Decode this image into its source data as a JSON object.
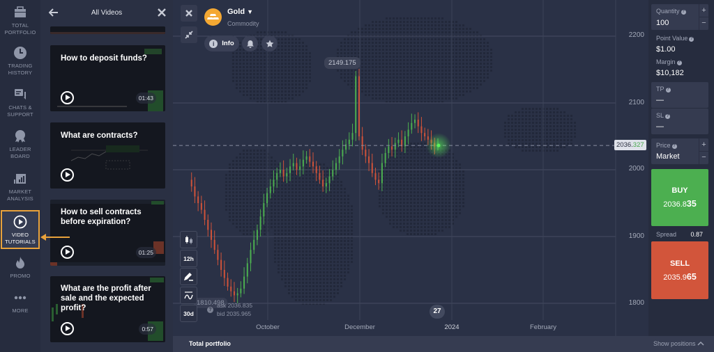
{
  "nav": {
    "items": [
      {
        "label_l1": "TOTAL",
        "label_l2": "PORTFOLIO",
        "icon": "briefcase-icon"
      },
      {
        "label_l1": "TRADING",
        "label_l2": "HISTORY",
        "icon": "clock-icon"
      },
      {
        "label_l1": "CHATS &",
        "label_l2": "SUPPORT",
        "icon": "chat-icon"
      },
      {
        "label_l1": "LEADER",
        "label_l2": "BOARD",
        "icon": "medal-icon"
      },
      {
        "label_l1": "MARKET",
        "label_l2": "ANALYSIS",
        "icon": "bar-chart-icon"
      },
      {
        "label_l1": "VIDEO",
        "label_l2": "TUTORIALS",
        "icon": "play-circle-icon",
        "active": true
      },
      {
        "label_l1": "PROMO",
        "label_l2": "",
        "icon": "flame-icon"
      },
      {
        "label_l1": "MORE",
        "label_l2": "",
        "icon": "more-dots-icon"
      }
    ],
    "highlight_color": "#e9a23b"
  },
  "videos_panel": {
    "title": "All Videos",
    "videos": [
      {
        "title": "How to deposit funds?",
        "duration": "01:43"
      },
      {
        "title": "What are contracts?",
        "duration": ""
      },
      {
        "title": "How to sell contracts before expiration?",
        "duration": "01:25"
      },
      {
        "title": "What are the profit after sale and the expected profit?",
        "duration": "0:57"
      }
    ]
  },
  "asset": {
    "name": "Gold",
    "type": "Commodity",
    "info_label": "Info"
  },
  "chart": {
    "high_label": "2149.175",
    "low_label": "1810.498",
    "current_price_main": "2036.",
    "current_price_tail": "327",
    "ask": "ask 2036.835",
    "bid": "bid 2035.965",
    "day_badge": "27",
    "y_ticks": [
      "2200",
      "2100",
      "2000",
      "1900",
      "1800"
    ],
    "x_ticks": [
      "October",
      "December",
      "2024",
      "February"
    ],
    "timeframe": "12h",
    "period": "30d",
    "up_color": "#4caf50",
    "down_color": "#d0533a"
  },
  "order": {
    "quantity_label": "Quantity",
    "quantity": "100",
    "point_value_label": "Point Value",
    "point_value": "$1.00",
    "margin_label": "Margin",
    "margin": "$10,182",
    "tp_label": "TP",
    "tp_value": "—",
    "sl_label": "SL",
    "sl_value": "—",
    "price_label": "Price",
    "price_value": "Market",
    "buy_label": "BUY",
    "buy_price_main": "2036.8",
    "buy_price_tail": "35",
    "spread_label": "Spread",
    "spread_value": "0.87",
    "sell_label": "SELL",
    "sell_price_main": "2035.9",
    "sell_price_tail": "65",
    "buy_color": "#4caf50",
    "sell_color": "#d2553b"
  },
  "bottom": {
    "total_portfolio": "Total portfolio",
    "show_positions": "Show positions"
  }
}
